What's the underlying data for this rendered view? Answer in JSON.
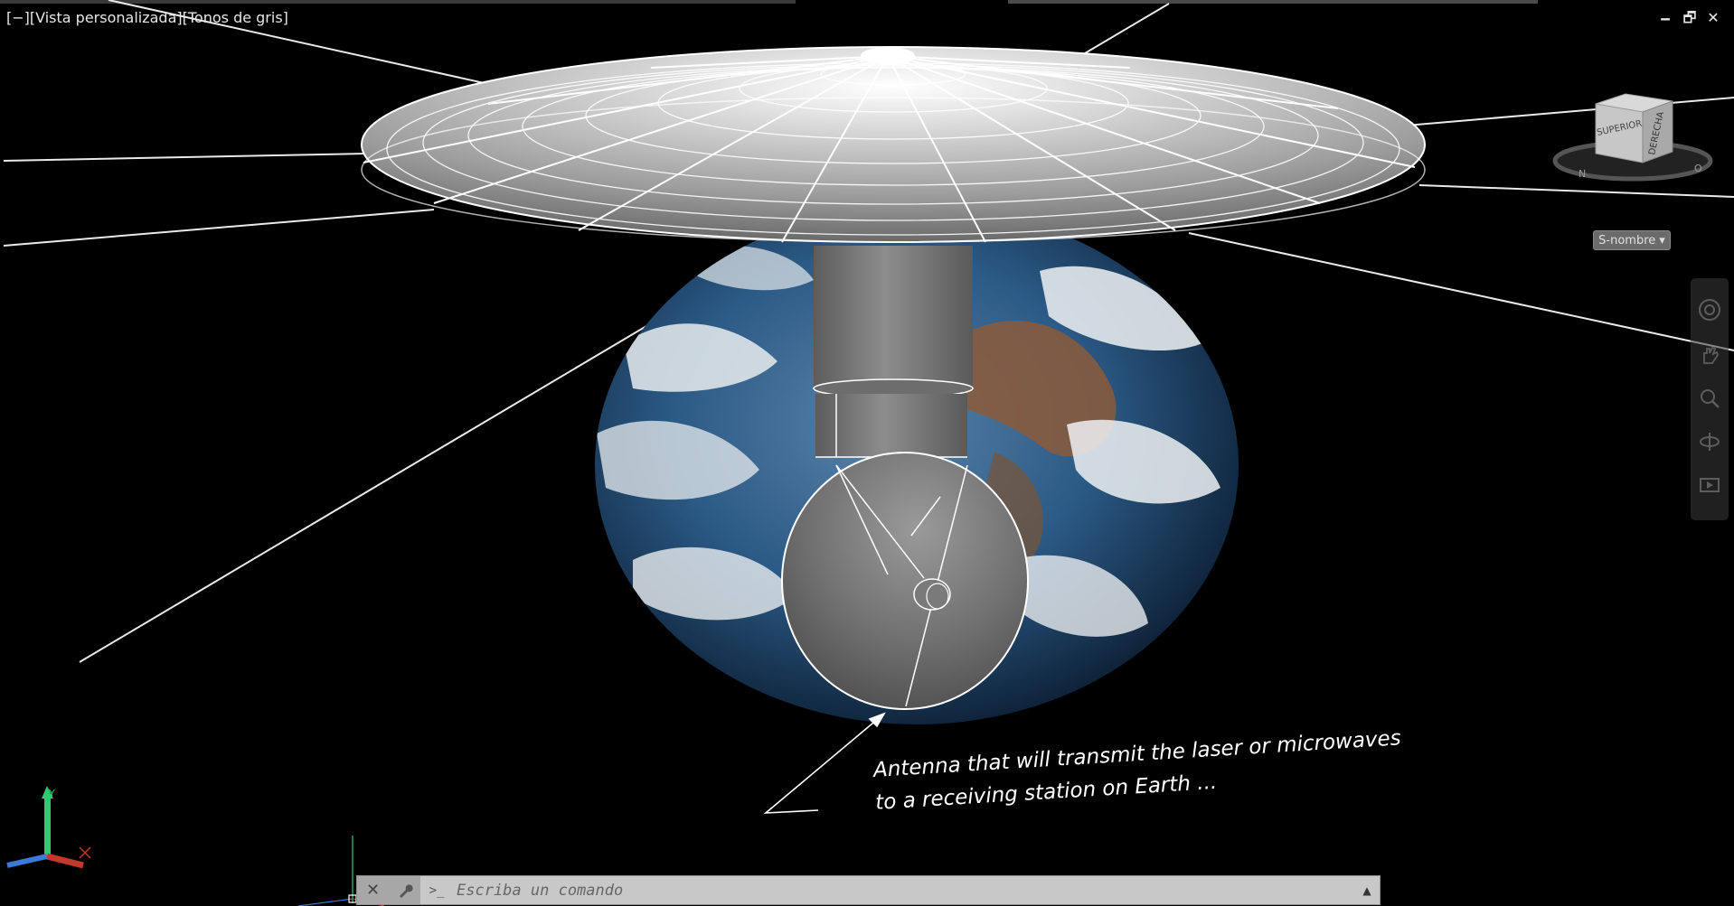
{
  "viewport": {
    "view_control": "[−]",
    "view_name": "[Vista personalizada]",
    "visual_style": "[Tonos de gris]"
  },
  "window_controls": {
    "minimize": "🗕",
    "restore": "🗗",
    "close": "✕"
  },
  "viewcube": {
    "top_face": "SUPERIOR",
    "right_face": "DERECHA",
    "compass_n": "N",
    "compass_o": "O"
  },
  "wcs_menu": {
    "label": "S-nombre",
    "arrow": "▾"
  },
  "annotation": {
    "line1": "Antenna that will transmit the laser or microwaves",
    "line2": "to a receiving station on Earth ..."
  },
  "ucs_icon": {
    "x": "X",
    "y": "Y",
    "z": "Z"
  },
  "command_line": {
    "close_icon": "✕",
    "customize_icon": "🔧",
    "prompt_icon": ">_",
    "placeholder": "Escriba un comando",
    "history_icon": "▲"
  },
  "colors": {
    "background": "#000000",
    "wire": "#f2f2f2",
    "solid_gray": "#7b7b7b",
    "ocean": "#1f4e7a",
    "cloud": "#e8ecef",
    "land": "#8c5a3a",
    "ucs_x": "#c0392b",
    "ucs_y": "#2ecc71",
    "ucs_z": "#3a7bd5",
    "cmdline_bg": "#c8c8c8"
  }
}
